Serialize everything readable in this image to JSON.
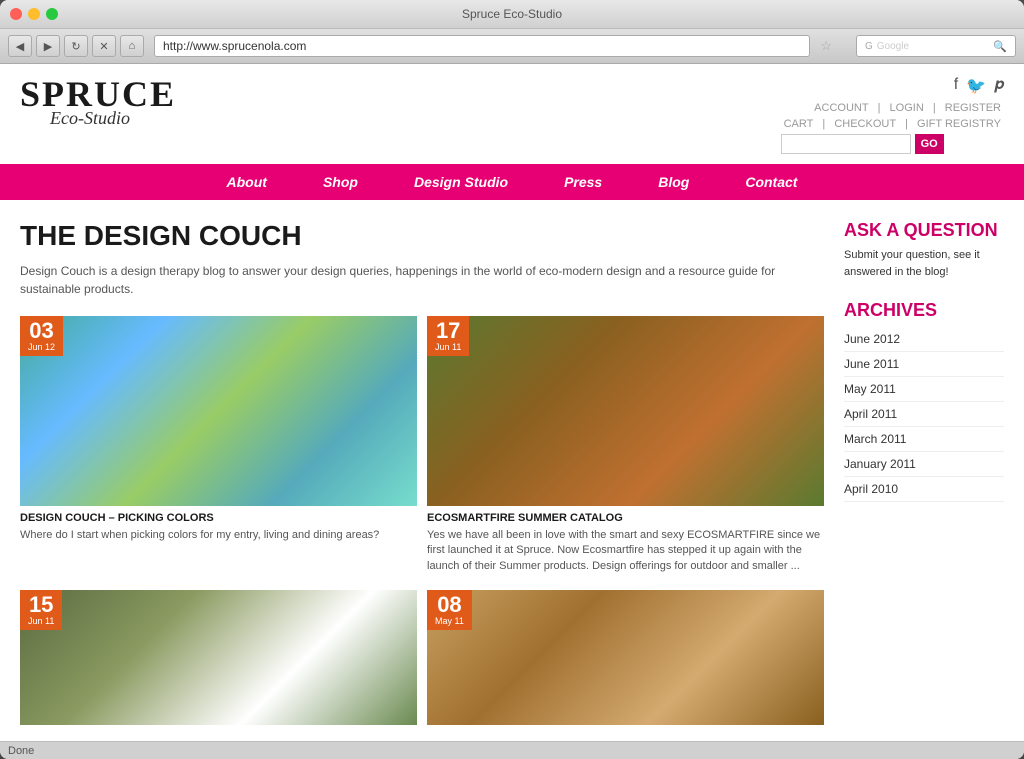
{
  "browser": {
    "title": "Spruce Eco-Studio",
    "url": "http://www.sprucenola.com",
    "search_placeholder": "Google",
    "status": "Done"
  },
  "header": {
    "logo_brand": "SPRUCE",
    "logo_sub": "Eco-Studio",
    "social": [
      "f",
      "🐦",
      "p"
    ],
    "links": {
      "account": "ACCOUNT",
      "sep1": "|",
      "login": "LOGIN",
      "sep2": "|",
      "register": "REGISTER",
      "cart": "CART",
      "sep3": "|",
      "checkout": "CHECKOUT",
      "sep4": "|",
      "gift": "GIFT REGISTRY"
    },
    "go_label": "GO"
  },
  "nav": {
    "items": [
      "About",
      "Shop",
      "Design Studio",
      "Press",
      "Blog",
      "Contact"
    ]
  },
  "blog": {
    "title": "THE DESIGN COUCH",
    "description": "Design Couch is a design therapy blog to answer your design queries, happenings in the world of eco-modern design and a resource guide for sustainable products."
  },
  "posts": [
    {
      "day": "03",
      "month": "Jun 12",
      "title": "DESIGN COUCH – PICKING COLORS",
      "excerpt": "Where do I start when picking colors for my entry, living and dining areas?"
    },
    {
      "day": "17",
      "month": "Jun 11",
      "title": "ECOSMARTFIRE SUMMER CATALOG",
      "excerpt": "Yes we have all been in love with the smart and sexy ECOSMARTFIRE since we first launched it at Spruce. Now Ecosmartfire has stepped it up again with the launch of their Summer products. Design offerings for outdoor and smaller ..."
    }
  ],
  "posts2": [
    {
      "day": "15",
      "month": "Jun 11"
    },
    {
      "day": "08",
      "month": "May 11"
    }
  ],
  "sidebar": {
    "ask_title": "ASK A QUESTION",
    "ask_text": "Submit your question, see it answered in the blog!",
    "archives_title": "ARCHIVES",
    "archives": [
      "June 2012",
      "June 2011",
      "May 2011",
      "April 2011",
      "March 2011",
      "January 2011",
      "April 2010"
    ]
  }
}
